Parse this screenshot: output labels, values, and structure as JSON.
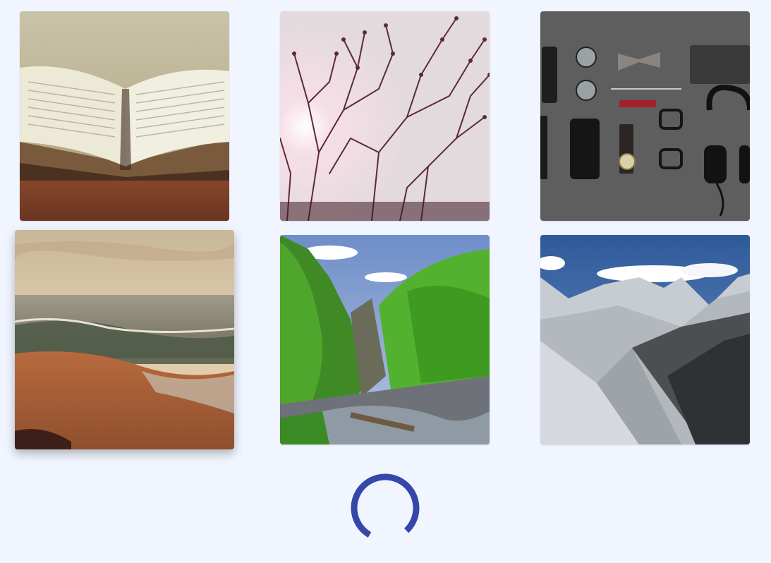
{
  "gallery": {
    "tiles": [
      {
        "subject": "open-book-photo"
      },
      {
        "subject": "tree-branches-sunlight-photo"
      },
      {
        "subject": "flat-lay-accessories-photo"
      },
      {
        "subject": "sea-shore-waves-photo",
        "state": "hovered"
      },
      {
        "subject": "forest-waterfall-photo"
      },
      {
        "subject": "snowy-mountains-photo"
      }
    ]
  },
  "loader": {
    "icon": "loading-spinner-icon",
    "color": "#3547a8"
  },
  "colors": {
    "background": "#f1f5ff",
    "accent": "#3547a8"
  }
}
